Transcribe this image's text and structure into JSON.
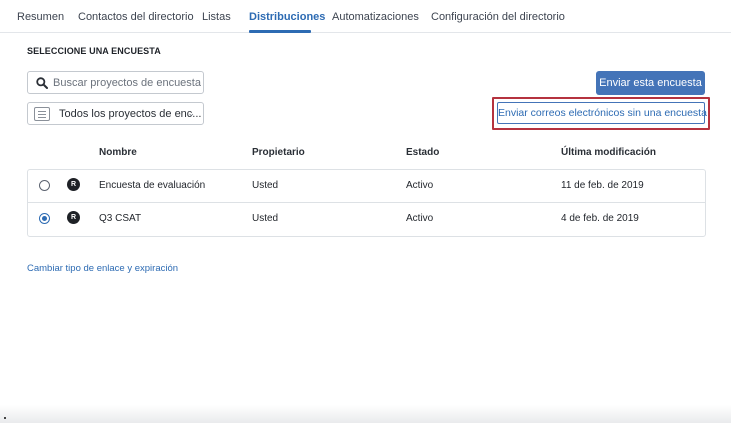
{
  "tabs": [
    {
      "label": "Resumen",
      "active": false
    },
    {
      "label": "Contactos del directorio",
      "active": false
    },
    {
      "label": "Listas",
      "active": false
    },
    {
      "label": "Distribuciones",
      "active": true
    },
    {
      "label": "Automatizaciones",
      "active": false
    },
    {
      "label": "Configuración del directorio",
      "active": false
    }
  ],
  "section_title": "SELECCIONE UNA ENCUESTA",
  "search": {
    "placeholder": "Buscar proyectos de encuestas...",
    "icon": "search-icon"
  },
  "project_filter": {
    "value": "Todos los proyectos de enc...",
    "icon": "document-icon"
  },
  "buttons": {
    "send_survey": "Enviar esta encuesta",
    "send_emails_without_survey": "Enviar correos electrónicos sin una encuesta"
  },
  "table": {
    "headers": [
      "Nombre",
      "Propietario",
      "Estado",
      "Última modificación"
    ],
    "rows": [
      {
        "selected": false,
        "badge": "R",
        "name": "Encuesta de evaluación",
        "owner": "Usted",
        "status": "Activo",
        "modified": "11 de feb. de 2019"
      },
      {
        "selected": true,
        "badge": "R",
        "name": "Q3 CSAT",
        "owner": "Usted",
        "status": "Activo",
        "modified": "4 de feb. de 2019"
      }
    ]
  },
  "link": "Cambiar tipo de enlace y expiración",
  "colors": {
    "accent": "#2d6bb3",
    "primary_button": "#4474b8",
    "highlight": "#b5333f"
  }
}
